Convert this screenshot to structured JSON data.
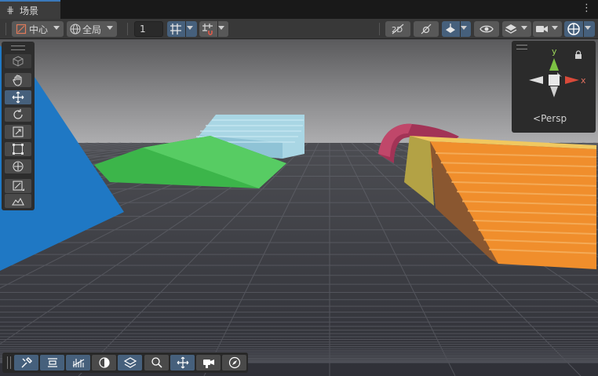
{
  "tab": {
    "title": "场景",
    "icon": "grid-icon",
    "menu_glyph": "⋮"
  },
  "toolbar": {
    "pivot_label": "中心",
    "space_label": "全局",
    "grid_value": "1"
  },
  "tools": [
    "view-hand",
    "move",
    "rotate",
    "scale",
    "rect",
    "transform",
    "custom-editor",
    "terrain"
  ],
  "gizmo": {
    "y_label": "y",
    "x_label": "x",
    "projection_label": "Persp"
  },
  "bottom_overlay": [
    "tools",
    "align",
    "navmesh",
    "lighting",
    "layers",
    "search",
    "move",
    "camera",
    "compass"
  ],
  "colors": {
    "accent": "#46607c",
    "tab_border": "#3a79bb",
    "sky": "#8a8a8a",
    "ground": "#3a3c44"
  }
}
